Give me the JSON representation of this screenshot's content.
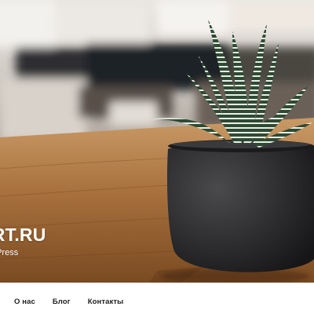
{
  "header": {
    "site_title_visible": "ART.RU",
    "site_description_visible": "WordPress"
  },
  "hero": {
    "image_subject": "zebra succulent in dark round pot on wooden table",
    "colors": {
      "wall": "#d9d4cf",
      "table": "#b07a45",
      "pot": "#2b2b2d",
      "plant": "#3f5a3f"
    }
  },
  "nav": {
    "items": [
      {
        "label": "О нас"
      },
      {
        "label": "Блог"
      },
      {
        "label": "Контакты"
      }
    ]
  }
}
